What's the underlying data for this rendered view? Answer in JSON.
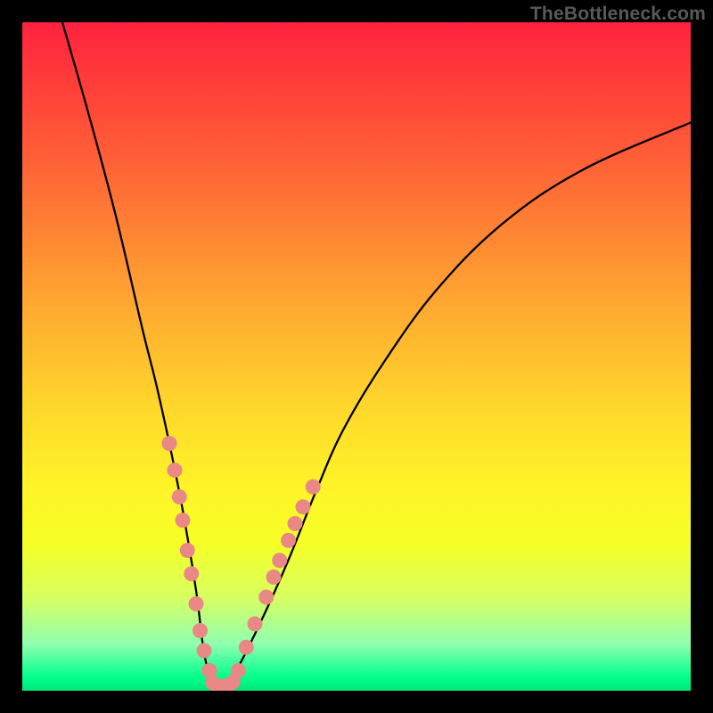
{
  "watermark": "TheBottleneck.com",
  "chart_data": {
    "type": "line",
    "title": "",
    "xlabel": "",
    "ylabel": "",
    "xlim": [
      0,
      100
    ],
    "ylim": [
      0,
      100
    ],
    "grid": false,
    "legend": false,
    "background": {
      "type": "vertical-gradient",
      "top_color": "#ff2240",
      "bottom_color": "#00e87a",
      "meaning": "red=high bottleneck, green=low bottleneck"
    },
    "series": [
      {
        "name": "bottleneck-curve",
        "description": "V-shaped bottleneck curve; minimum at the optimal pairing",
        "color": "#000000",
        "x": [
          6,
          10,
          14,
          18,
          20,
          22,
          24,
          26,
          27,
          28,
          29,
          30,
          32,
          36,
          40,
          44,
          48,
          54,
          62,
          72,
          84,
          100
        ],
        "values": [
          100,
          86,
          71,
          54,
          46,
          37,
          27,
          15,
          7,
          2,
          0.5,
          0.5,
          3,
          11,
          20,
          30,
          39,
          49,
          60,
          70,
          78,
          85
        ]
      }
    ],
    "markers": {
      "name": "highlight-points",
      "description": "Salient sample points along curve near the minimum",
      "color": "#e98884",
      "points": [
        {
          "x": 22.0,
          "y": 37.0
        },
        {
          "x": 22.8,
          "y": 33.0
        },
        {
          "x": 23.5,
          "y": 29.0
        },
        {
          "x": 24.0,
          "y": 25.5
        },
        {
          "x": 24.7,
          "y": 21.0
        },
        {
          "x": 25.3,
          "y": 17.5
        },
        {
          "x": 26.0,
          "y": 13.0
        },
        {
          "x": 26.6,
          "y": 9.0
        },
        {
          "x": 27.2,
          "y": 6.0
        },
        {
          "x": 28.0,
          "y": 3.0
        },
        {
          "x": 28.5,
          "y": 1.2
        },
        {
          "x": 29.2,
          "y": 0.6
        },
        {
          "x": 30.0,
          "y": 0.6
        },
        {
          "x": 30.8,
          "y": 0.7
        },
        {
          "x": 31.5,
          "y": 1.3
        },
        {
          "x": 32.3,
          "y": 3.0
        },
        {
          "x": 33.5,
          "y": 6.5
        },
        {
          "x": 34.8,
          "y": 10.0
        },
        {
          "x": 36.5,
          "y": 14.0
        },
        {
          "x": 37.6,
          "y": 17.0
        },
        {
          "x": 38.5,
          "y": 19.5
        },
        {
          "x": 39.8,
          "y": 22.5
        },
        {
          "x": 40.8,
          "y": 25.0
        },
        {
          "x": 42.0,
          "y": 27.5
        },
        {
          "x": 43.5,
          "y": 30.5
        }
      ]
    },
    "minimum": {
      "x": 29.5,
      "y": 0.5
    }
  }
}
